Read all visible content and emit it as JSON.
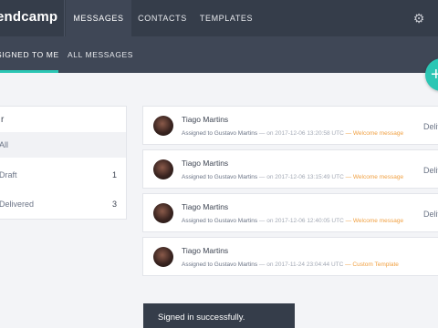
{
  "app": {
    "logo_text": "endcamp"
  },
  "nav": {
    "tabs": [
      {
        "label": "MESSAGES",
        "active": true
      },
      {
        "label": "CONTACTS",
        "active": false
      },
      {
        "label": "TEMPLATES",
        "active": false
      }
    ],
    "settings_icon": "gear-icon"
  },
  "subnav": {
    "tabs": [
      {
        "label": "SIGNED TO ME",
        "active": true
      },
      {
        "label": "ALL MESSAGES",
        "active": false
      }
    ],
    "fab_icon": "plus-icon",
    "fab_label": "+"
  },
  "filter": {
    "title": "r",
    "items": [
      {
        "label": "All",
        "count": "",
        "active": true
      },
      {
        "label": "Draft",
        "count": "1",
        "active": false
      },
      {
        "label": "Delivered",
        "count": "3",
        "active": false
      }
    ]
  },
  "messages": [
    {
      "name": "Tiago Martins",
      "assigned": "Assigned to Gustavo Martins",
      "time": "— on 2017-12-06 13:20:58 UTC",
      "template": "— Welcome message",
      "status": "Deliv"
    },
    {
      "name": "Tiago Martins",
      "assigned": "Assigned to Gustavo Martins",
      "time": "— on 2017-12-06 13:15:49 UTC",
      "template": "— Welcome message",
      "status": "Deliv"
    },
    {
      "name": "Tiago Martins",
      "assigned": "Assigned to Gustavo Martins",
      "time": "— on 2017-12-06 12:40:05 UTC",
      "template": "— Welcome message",
      "status": "Deliv"
    },
    {
      "name": "Tiago Martins",
      "assigned": "Assigned to Gustavo Martins",
      "time": "— on 2017-11-24 23:04:44 UTC",
      "template": "— Custom Template",
      "status": ""
    }
  ],
  "toast": {
    "text": "Signed in successfully."
  },
  "colors": {
    "accent": "#2bc6b4",
    "topbar": "#353d4a",
    "template_link": "#f0a042"
  }
}
